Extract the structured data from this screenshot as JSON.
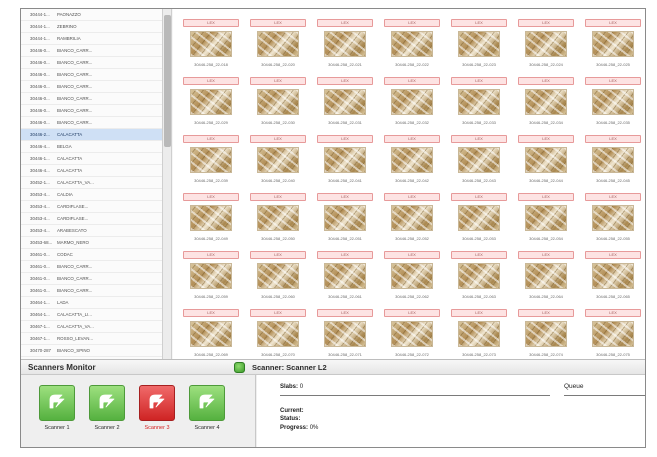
{
  "slab_list": [
    {
      "code": "30444-1...",
      "desc": "PAONAZZO"
    },
    {
      "code": "30444-1...",
      "desc": "ZEBRINO"
    },
    {
      "code": "30444-1...",
      "desc": "RAMBRILIA"
    },
    {
      "code": "30446-0...",
      "desc": "BIANCO_CARR..."
    },
    {
      "code": "30446-0...",
      "desc": "BIANCO_CARR..."
    },
    {
      "code": "30446-0...",
      "desc": "BIANCO_CARR..."
    },
    {
      "code": "30446-0...",
      "desc": "BIANCO_CARR..."
    },
    {
      "code": "30446-0...",
      "desc": "BIANCO_CARR..."
    },
    {
      "code": "30446-0...",
      "desc": "BIANCO_CARR..."
    },
    {
      "code": "30446-0...",
      "desc": "BIANCO_CARR..."
    },
    {
      "code": "30446-2...",
      "desc": "CALACATTA",
      "selected": true
    },
    {
      "code": "30446-4...",
      "desc": "BELGA"
    },
    {
      "code": "30446-1...",
      "desc": "CALACATTA"
    },
    {
      "code": "30446-4...",
      "desc": "CALACATTA"
    },
    {
      "code": "30452-1...",
      "desc": "CALACATTA_VA..."
    },
    {
      "code": "30453-4...",
      "desc": "CALDIA"
    },
    {
      "code": "30453-4...",
      "desc": "CARDIFLASE..."
    },
    {
      "code": "30453-4...",
      "desc": "CARDIFLASE..."
    },
    {
      "code": "30453-4...",
      "desc": "ARABESCATO"
    },
    {
      "code": "30453-68...",
      "desc": "MARMO_NERO"
    },
    {
      "code": "30461-0...",
      "desc": "CODAC"
    },
    {
      "code": "30461-0...",
      "desc": "BIANCO_CARR..."
    },
    {
      "code": "30461-0...",
      "desc": "BIANCO_CARR..."
    },
    {
      "code": "30461-0...",
      "desc": "BIANCO_CARR..."
    },
    {
      "code": "30464-1...",
      "desc": "LADA"
    },
    {
      "code": "30464-1...",
      "desc": "CALACATTA_LI..."
    },
    {
      "code": "30467-1...",
      "desc": "CALACATTA_VA..."
    },
    {
      "code": "30467-1...",
      "desc": "ROSSO_LEVAN..."
    },
    {
      "code": "30470-287",
      "desc": "BIANCO_SPINO"
    },
    {
      "code": "30470-407",
      "desc": "CALACATTA"
    }
  ],
  "slab_grid": {
    "tag_label": "LEX",
    "rows": [
      [
        "30446-258_22-018",
        "30446-258_22-020",
        "30446-258_22-021",
        "30446-258_22-022",
        "30446-258_22-023",
        "30446-258_22-024",
        "30446-258_22-025"
      ],
      [
        "30446-258_22-029",
        "30446-258_22-030",
        "30446-258_22-031",
        "30446-258_22-032",
        "30446-258_22-033",
        "30446-258_22-034",
        "30446-258_22-035"
      ],
      [
        "30446-258_22-039",
        "30446-258_22-040",
        "30446-258_22-041",
        "30446-258_22-042",
        "30446-258_22-043",
        "30446-258_22-044",
        "30446-258_22-045"
      ],
      [
        "30446-258_22-049",
        "30446-258_22-050",
        "30446-258_22-051",
        "30446-258_22-052",
        "30446-258_22-053",
        "30446-258_22-054",
        "30446-258_22-055"
      ],
      [
        "30446-258_22-059",
        "30446-258_22-060",
        "30446-258_22-061",
        "30446-258_22-062",
        "30446-258_22-063",
        "30446-258_22-064",
        "30446-258_22-065"
      ],
      [
        "30446-258_22-069",
        "30446-258_22-070",
        "30446-258_22-071",
        "30446-258_22-072",
        "30446-258_22-073",
        "30446-258_22-074",
        "30446-258_22-075"
      ]
    ]
  },
  "monitor": {
    "title": "Scanners Monitor",
    "scanners": [
      {
        "label": "Scanner 1",
        "active": false
      },
      {
        "label": "Scanner 2",
        "active": false
      },
      {
        "label": "Scanner 3",
        "active": true
      },
      {
        "label": "Scanner 4",
        "active": false
      }
    ]
  },
  "scanner_detail": {
    "title": "Scanner: Scanner L2",
    "slabs_label": "Slabs:",
    "slabs_value": "0",
    "queue_label": "Queue",
    "current_label": "Current:",
    "current_value": "",
    "status_label": "Status:",
    "status_value": "",
    "progress_label": "Progress:",
    "progress_value": "0%"
  },
  "colors": {
    "scanner_idle": "#55b13f",
    "scanner_active": "#cf2424",
    "selected_row": "#cfe0f5"
  }
}
